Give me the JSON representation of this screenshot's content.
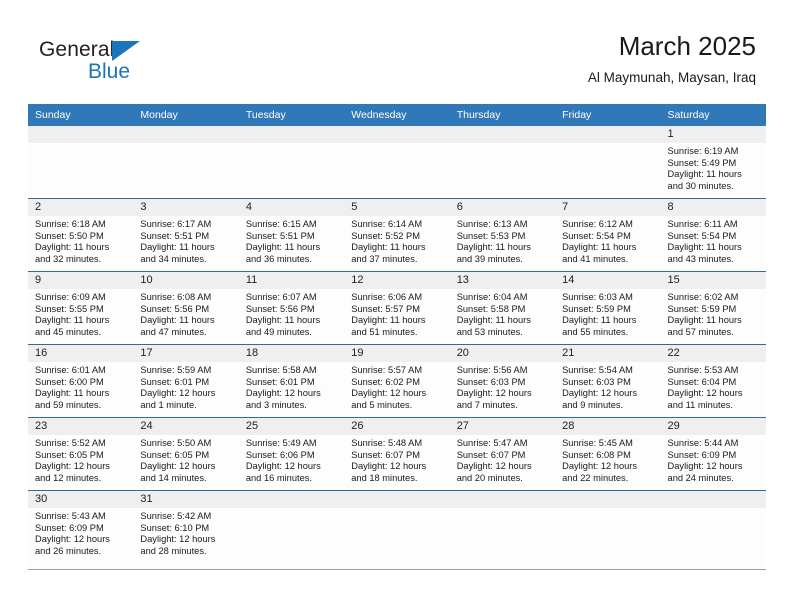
{
  "brand": {
    "name_part1": "General",
    "name_part2": "Blue",
    "triangle_color": "#1b75bb"
  },
  "header": {
    "title": "March 2025",
    "subtitle": "Al Maymunah, Maysan, Iraq",
    "accent_color": "#3178b8",
    "row_divider_color": "#2e6da4",
    "daynum_band_color": "#efefef"
  },
  "weekday_headers": [
    "Sunday",
    "Monday",
    "Tuesday",
    "Wednesday",
    "Thursday",
    "Friday",
    "Saturday"
  ],
  "labels": {
    "sunrise_prefix": "Sunrise:",
    "sunset_prefix": "Sunset:",
    "daylight_prefix": "Daylight:"
  },
  "weeks": [
    [
      {
        "day": "",
        "lines": []
      },
      {
        "day": "",
        "lines": []
      },
      {
        "day": "",
        "lines": []
      },
      {
        "day": "",
        "lines": []
      },
      {
        "day": "",
        "lines": []
      },
      {
        "day": "",
        "lines": []
      },
      {
        "day": "1",
        "lines": [
          "Sunrise: 6:19 AM",
          "Sunset: 5:49 PM",
          "Daylight: 11 hours",
          "and 30 minutes."
        ]
      }
    ],
    [
      {
        "day": "2",
        "lines": [
          "Sunrise: 6:18 AM",
          "Sunset: 5:50 PM",
          "Daylight: 11 hours",
          "and 32 minutes."
        ]
      },
      {
        "day": "3",
        "lines": [
          "Sunrise: 6:17 AM",
          "Sunset: 5:51 PM",
          "Daylight: 11 hours",
          "and 34 minutes."
        ]
      },
      {
        "day": "4",
        "lines": [
          "Sunrise: 6:15 AM",
          "Sunset: 5:51 PM",
          "Daylight: 11 hours",
          "and 36 minutes."
        ]
      },
      {
        "day": "5",
        "lines": [
          "Sunrise: 6:14 AM",
          "Sunset: 5:52 PM",
          "Daylight: 11 hours",
          "and 37 minutes."
        ]
      },
      {
        "day": "6",
        "lines": [
          "Sunrise: 6:13 AM",
          "Sunset: 5:53 PM",
          "Daylight: 11 hours",
          "and 39 minutes."
        ]
      },
      {
        "day": "7",
        "lines": [
          "Sunrise: 6:12 AM",
          "Sunset: 5:54 PM",
          "Daylight: 11 hours",
          "and 41 minutes."
        ]
      },
      {
        "day": "8",
        "lines": [
          "Sunrise: 6:11 AM",
          "Sunset: 5:54 PM",
          "Daylight: 11 hours",
          "and 43 minutes."
        ]
      }
    ],
    [
      {
        "day": "9",
        "lines": [
          "Sunrise: 6:09 AM",
          "Sunset: 5:55 PM",
          "Daylight: 11 hours",
          "and 45 minutes."
        ]
      },
      {
        "day": "10",
        "lines": [
          "Sunrise: 6:08 AM",
          "Sunset: 5:56 PM",
          "Daylight: 11 hours",
          "and 47 minutes."
        ]
      },
      {
        "day": "11",
        "lines": [
          "Sunrise: 6:07 AM",
          "Sunset: 5:56 PM",
          "Daylight: 11 hours",
          "and 49 minutes."
        ]
      },
      {
        "day": "12",
        "lines": [
          "Sunrise: 6:06 AM",
          "Sunset: 5:57 PM",
          "Daylight: 11 hours",
          "and 51 minutes."
        ]
      },
      {
        "day": "13",
        "lines": [
          "Sunrise: 6:04 AM",
          "Sunset: 5:58 PM",
          "Daylight: 11 hours",
          "and 53 minutes."
        ]
      },
      {
        "day": "14",
        "lines": [
          "Sunrise: 6:03 AM",
          "Sunset: 5:59 PM",
          "Daylight: 11 hours",
          "and 55 minutes."
        ]
      },
      {
        "day": "15",
        "lines": [
          "Sunrise: 6:02 AM",
          "Sunset: 5:59 PM",
          "Daylight: 11 hours",
          "and 57 minutes."
        ]
      }
    ],
    [
      {
        "day": "16",
        "lines": [
          "Sunrise: 6:01 AM",
          "Sunset: 6:00 PM",
          "Daylight: 11 hours",
          "and 59 minutes."
        ]
      },
      {
        "day": "17",
        "lines": [
          "Sunrise: 5:59 AM",
          "Sunset: 6:01 PM",
          "Daylight: 12 hours",
          "and 1 minute."
        ]
      },
      {
        "day": "18",
        "lines": [
          "Sunrise: 5:58 AM",
          "Sunset: 6:01 PM",
          "Daylight: 12 hours",
          "and 3 minutes."
        ]
      },
      {
        "day": "19",
        "lines": [
          "Sunrise: 5:57 AM",
          "Sunset: 6:02 PM",
          "Daylight: 12 hours",
          "and 5 minutes."
        ]
      },
      {
        "day": "20",
        "lines": [
          "Sunrise: 5:56 AM",
          "Sunset: 6:03 PM",
          "Daylight: 12 hours",
          "and 7 minutes."
        ]
      },
      {
        "day": "21",
        "lines": [
          "Sunrise: 5:54 AM",
          "Sunset: 6:03 PM",
          "Daylight: 12 hours",
          "and 9 minutes."
        ]
      },
      {
        "day": "22",
        "lines": [
          "Sunrise: 5:53 AM",
          "Sunset: 6:04 PM",
          "Daylight: 12 hours",
          "and 11 minutes."
        ]
      }
    ],
    [
      {
        "day": "23",
        "lines": [
          "Sunrise: 5:52 AM",
          "Sunset: 6:05 PM",
          "Daylight: 12 hours",
          "and 12 minutes."
        ]
      },
      {
        "day": "24",
        "lines": [
          "Sunrise: 5:50 AM",
          "Sunset: 6:05 PM",
          "Daylight: 12 hours",
          "and 14 minutes."
        ]
      },
      {
        "day": "25",
        "lines": [
          "Sunrise: 5:49 AM",
          "Sunset: 6:06 PM",
          "Daylight: 12 hours",
          "and 16 minutes."
        ]
      },
      {
        "day": "26",
        "lines": [
          "Sunrise: 5:48 AM",
          "Sunset: 6:07 PM",
          "Daylight: 12 hours",
          "and 18 minutes."
        ]
      },
      {
        "day": "27",
        "lines": [
          "Sunrise: 5:47 AM",
          "Sunset: 6:07 PM",
          "Daylight: 12 hours",
          "and 20 minutes."
        ]
      },
      {
        "day": "28",
        "lines": [
          "Sunrise: 5:45 AM",
          "Sunset: 6:08 PM",
          "Daylight: 12 hours",
          "and 22 minutes."
        ]
      },
      {
        "day": "29",
        "lines": [
          "Sunrise: 5:44 AM",
          "Sunset: 6:09 PM",
          "Daylight: 12 hours",
          "and 24 minutes."
        ]
      }
    ],
    [
      {
        "day": "30",
        "lines": [
          "Sunrise: 5:43 AM",
          "Sunset: 6:09 PM",
          "Daylight: 12 hours",
          "and 26 minutes."
        ]
      },
      {
        "day": "31",
        "lines": [
          "Sunrise: 5:42 AM",
          "Sunset: 6:10 PM",
          "Daylight: 12 hours",
          "and 28 minutes."
        ]
      },
      {
        "day": "",
        "lines": []
      },
      {
        "day": "",
        "lines": []
      },
      {
        "day": "",
        "lines": []
      },
      {
        "day": "",
        "lines": []
      },
      {
        "day": "",
        "lines": []
      }
    ]
  ]
}
